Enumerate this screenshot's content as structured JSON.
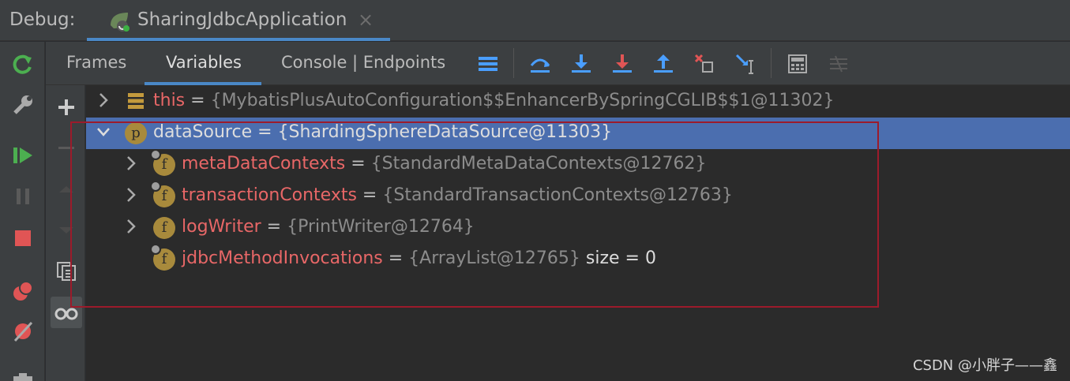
{
  "debug": {
    "label": "Debug:",
    "run_tab": {
      "title": "SharingJdbcApplication",
      "close": "×"
    }
  },
  "tabs": [
    {
      "label": "Frames"
    },
    {
      "label": "Variables"
    },
    {
      "label": "Console | Endpoints"
    }
  ],
  "toolbar_icons": [
    "menu-icon",
    "step-over-icon",
    "step-into-icon",
    "force-step-into-icon",
    "step-out-icon",
    "drop-frame-icon",
    "run-to-cursor-icon",
    "evaluate-expression-icon",
    "trace-stream-icon"
  ],
  "left_toolbar_icons": [
    "rerun-icon",
    "settings-wrench-icon",
    "resume-icon",
    "pause-icon",
    "stop-icon",
    "view-breakpoints-icon",
    "mute-breakpoints-icon",
    "camera-icon"
  ],
  "side_toolbar_icons": [
    "add-watch-icon",
    "remove-watch-icon",
    "move-up-icon",
    "move-down-icon",
    "copy-icon",
    "show-watches-icon"
  ],
  "variables": [
    {
      "name": "this",
      "eq": " = ",
      "value": "{MybatisPlusAutoConfiguration$$EnhancerBySpringCGLIB$$1@11302}",
      "badge": "",
      "extra": ""
    },
    {
      "name": "dataSource",
      "eq": " = ",
      "value": "{ShardingSphereDataSource@11303}",
      "badge": "p",
      "extra": ""
    },
    {
      "name": "metaDataContexts",
      "eq": " = ",
      "value": "{StandardMetaDataContexts@12762}",
      "badge": "f",
      "extra": ""
    },
    {
      "name": "transactionContexts",
      "eq": " = ",
      "value": "{StandardTransactionContexts@12763}",
      "badge": "f",
      "extra": ""
    },
    {
      "name": "logWriter",
      "eq": " = ",
      "value": "{PrintWriter@12764}",
      "badge": "f",
      "extra": ""
    },
    {
      "name": "jdbcMethodInvocations",
      "eq": " = ",
      "value": "{ArrayList@12765}",
      "badge": "f",
      "extra": "  size = 0"
    }
  ],
  "watermark": "CSDN @小胖子——鑫",
  "colors": {
    "accent": "#4a88c7",
    "selection": "#4b6eaf",
    "field_name": "#e86767",
    "highlight_box": "#9c1b2b"
  }
}
